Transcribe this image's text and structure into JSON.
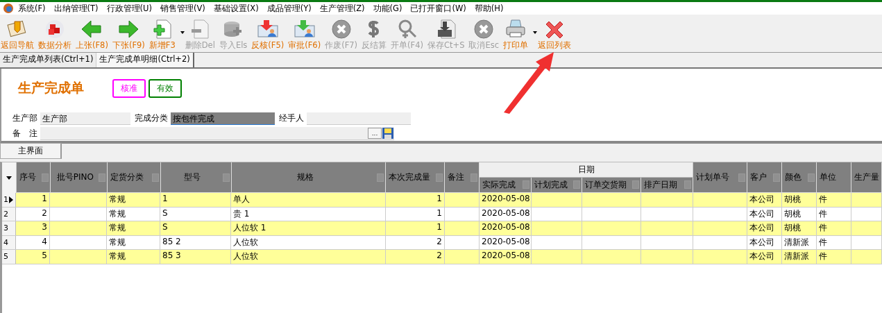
{
  "menu": [
    {
      "label": "系统(F)"
    },
    {
      "label": "出纳管理(T)"
    },
    {
      "label": "行政管理(U)"
    },
    {
      "label": "销售管理(V)"
    },
    {
      "label": "基础设置(X)"
    },
    {
      "label": "成品管理(Y)"
    },
    {
      "label": "生产管理(Z)"
    },
    {
      "label": "功能(G)"
    },
    {
      "label": "已打开窗口(W)"
    },
    {
      "label": "帮助(H)"
    }
  ],
  "toolbar": [
    {
      "label": "返回导航",
      "kind": "envelope",
      "disabled": false,
      "has_menu": false
    },
    {
      "label": "数据分析",
      "kind": "cubes",
      "disabled": false,
      "has_menu": false
    },
    {
      "label": "上张(F8)",
      "kind": "left",
      "disabled": false,
      "has_menu": false
    },
    {
      "label": "下张(F9)",
      "kind": "right",
      "disabled": false,
      "has_menu": false
    },
    {
      "label": "新增F3",
      "kind": "add",
      "disabled": false,
      "has_menu": true
    },
    {
      "label": "删除Del",
      "kind": "remove",
      "disabled": true,
      "has_menu": false
    },
    {
      "label": "导入Els",
      "kind": "database",
      "disabled": true,
      "has_menu": false
    },
    {
      "label": "反核(F5)",
      "kind": "down-red",
      "disabled": false,
      "has_menu": false
    },
    {
      "label": "审批(F6)",
      "kind": "down-green",
      "disabled": false,
      "has_menu": false
    },
    {
      "label": "作废(F7)",
      "kind": "circle-x",
      "disabled": true,
      "has_menu": false
    },
    {
      "label": "反结算",
      "kind": "dollar",
      "disabled": true,
      "has_menu": false
    },
    {
      "label": "开单(F4)",
      "kind": "magnifier",
      "disabled": true,
      "has_menu": false
    },
    {
      "label": "保存Ct+S",
      "kind": "save",
      "disabled": true,
      "has_menu": false
    },
    {
      "label": "取消Esc",
      "kind": "circle-x",
      "disabled": true,
      "has_menu": false
    },
    {
      "label": "打印单",
      "kind": "printer",
      "disabled": false,
      "has_menu": true
    },
    {
      "label": "返回列表",
      "kind": "red-x",
      "disabled": false,
      "has_menu": false
    }
  ],
  "doc_tabs": [
    {
      "label": "生产完成单列表(Ctrl+1)",
      "selected": false
    },
    {
      "label": "生产完成单明细(Ctrl+2)",
      "selected": true
    }
  ],
  "form": {
    "title": "生产完成单",
    "badges": [
      {
        "label": "核准",
        "color": "#ff00ff"
      },
      {
        "label": "有效",
        "color": "#008000"
      }
    ],
    "fields": [
      {
        "label": "生产部",
        "value": "生产部",
        "selected": false
      },
      {
        "label": "完成分类",
        "value": "按包件完成",
        "selected": true
      },
      {
        "label": "经手人",
        "selected": false
      }
    ],
    "remark": {
      "label": "备　注",
      "button": "..."
    }
  },
  "sub_tabs": [
    {
      "label": "主界面",
      "selected": true
    }
  ],
  "table": {
    "group_header": "日期",
    "columns": [
      {
        "label": "序号"
      },
      {
        "label": "批号PINO"
      },
      {
        "label": "定货分类"
      },
      {
        "label": "型号"
      },
      {
        "label": "规格"
      },
      {
        "label": "本次完成量"
      },
      {
        "label": "备注"
      },
      {
        "label": "实际完成"
      },
      {
        "label": "计划完成"
      },
      {
        "label": "订单交货期"
      },
      {
        "label": "排产日期"
      },
      {
        "label": "计划单号"
      },
      {
        "label": "客户"
      },
      {
        "label": "颜色"
      },
      {
        "label": "单位"
      },
      {
        "label": "生产量"
      }
    ],
    "rows": [
      {
        "row_number": "1",
        "current": true,
        "cells": [
          "1",
          "",
          "常规",
          "1",
          "单人",
          "1",
          "",
          "2020-05-08",
          "",
          "",
          "",
          "",
          "本公司",
          "胡桃",
          "件",
          ""
        ]
      },
      {
        "row_number": "2",
        "current": false,
        "cells": [
          "2",
          "",
          "常规",
          "S",
          "贵 1",
          "1",
          "",
          "2020-05-08",
          "",
          "",
          "",
          "",
          "本公司",
          "胡桃",
          "件",
          ""
        ]
      },
      {
        "row_number": "3",
        "current": false,
        "cells": [
          "3",
          "",
          "常规",
          "S",
          "人位软 1",
          "1",
          "",
          "2020-05-08",
          "",
          "",
          "",
          "",
          "本公司",
          "胡桃",
          "件",
          ""
        ]
      },
      {
        "row_number": "4",
        "current": false,
        "cells": [
          "4",
          "",
          "常规",
          "85 2",
          "人位软",
          "2",
          "",
          "2020-05-08",
          "",
          "",
          "",
          "",
          "本公司",
          "清新派",
          "件",
          ""
        ]
      },
      {
        "row_number": "5",
        "current": false,
        "cells": [
          "5",
          "",
          "常规",
          "85 3",
          "人位软",
          "2",
          "",
          "2020-05-08",
          "",
          "",
          "",
          "",
          "本公司",
          "清新派",
          "件",
          ""
        ]
      }
    ]
  }
}
